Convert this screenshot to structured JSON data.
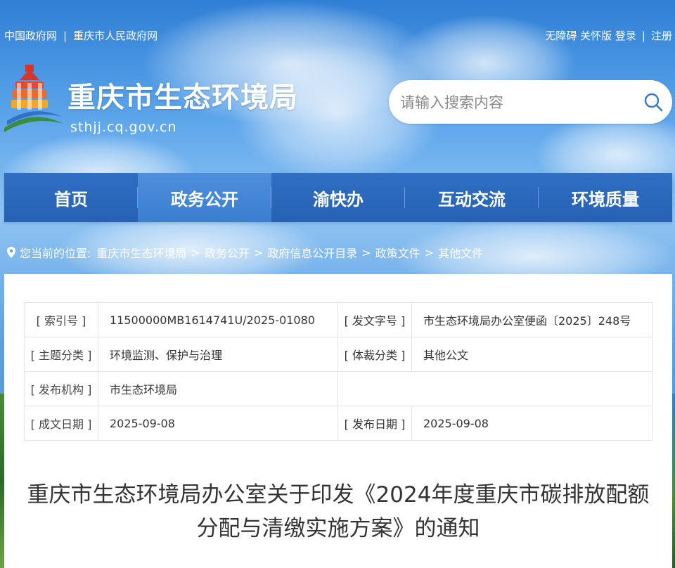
{
  "top_links": {
    "left": [
      "中国政府网",
      "重庆市人民政府网"
    ],
    "right": [
      "无障碍 关怀版 登录",
      "注册"
    ]
  },
  "site": {
    "title": "重庆市生态环境局",
    "domain": "sthjj.cq.gov.cn"
  },
  "search": {
    "placeholder": "请输入搜索内容"
  },
  "nav": [
    {
      "label": "首页",
      "active": false
    },
    {
      "label": "政务公开",
      "active": true
    },
    {
      "label": "渝快办",
      "active": false
    },
    {
      "label": "互动交流",
      "active": false
    },
    {
      "label": "环境质量",
      "active": false
    }
  ],
  "breadcrumb": {
    "prefix": "您当前的位置:",
    "items": [
      "重庆市生态环境局",
      "政务公开",
      "政府信息公开目录",
      "政策文件",
      "其他文件"
    ],
    "arrow": ">"
  },
  "meta": {
    "index_label": "[ 索引号 ]",
    "index_value": "11500000MB1614741U/2025-01080",
    "docno_label": "[ 发文字号 ]",
    "docno_value": "市生态环境局办公室便函〔2025〕248号",
    "topic_label": "[ 主题分类 ]",
    "topic_value": "环境监测、保护与治理",
    "genre_label": "[ 体裁分类 ]",
    "genre_value": "其他公文",
    "org_label": "[ 发布机构 ]",
    "org_value": "市生态环境局",
    "created_label": "[ 成文日期 ]",
    "created_value": "2025-09-08",
    "published_label": "[ 发布日期 ]",
    "published_value": "2025-09-08"
  },
  "document": {
    "title": "重庆市生态环境局办公室关于印发《2024年度重庆市碳排放配额分配与清缴实施方案》的通知"
  },
  "colors": {
    "nav_bg": "#2761b3",
    "nav_active": "#3b7ed0",
    "sky": "#5aa3ea"
  }
}
